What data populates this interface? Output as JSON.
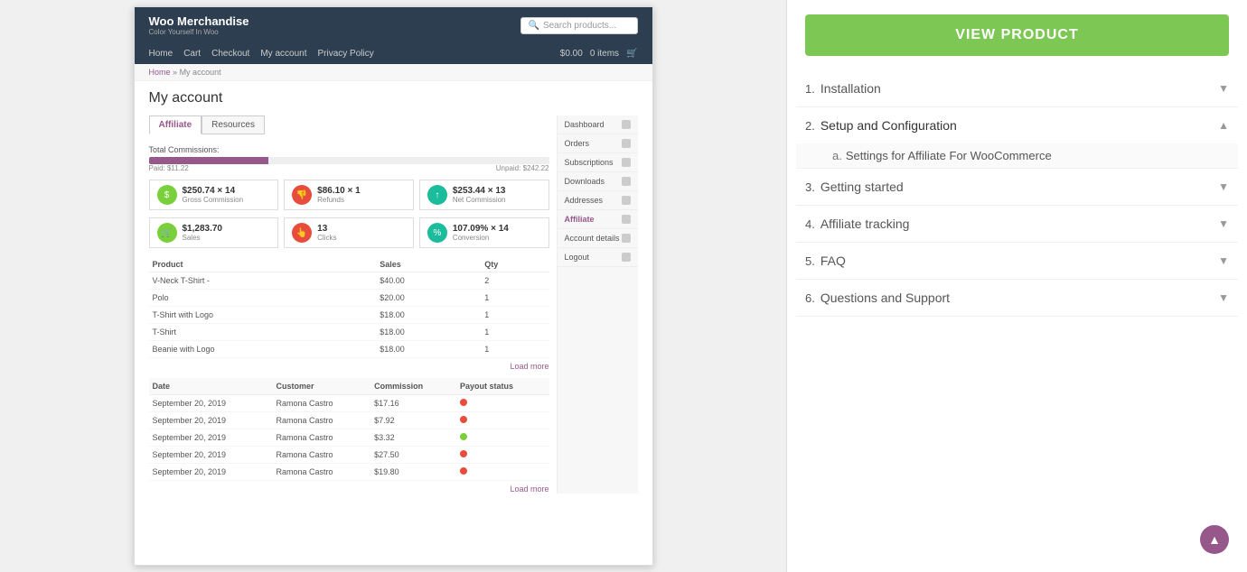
{
  "woo": {
    "brand_name": "Woo Merchandise",
    "brand_tagline": "Color Yourself In Woo",
    "search_placeholder": "Search products...",
    "nav_links": [
      "Home",
      "Cart",
      "Checkout",
      "My account",
      "Privacy Policy"
    ],
    "cart_amount": "$0.00",
    "cart_items": "0 items",
    "breadcrumb_home": "Home",
    "breadcrumb_separator": "»",
    "breadcrumb_current": "My account",
    "page_title": "My account",
    "tabs": [
      "Affiliate",
      "Resources"
    ],
    "commission_label": "Total Commissions:",
    "commission_paid": "Paid: $11.22",
    "commission_unpaid": "Unpaid: $242.22",
    "stat_gross": "$250.74 × 14",
    "stat_gross_label": "Gross Commission",
    "stat_refund": "$86.10 × 1",
    "stat_refund_label": "Refunds",
    "stat_net": "$253.44 × 13",
    "stat_net_label": "Net Commission",
    "stat_sales": "$1,283.70",
    "stat_sales_label": "Sales",
    "stat_clicks": "13",
    "stat_clicks_label": "Clicks",
    "stat_conversion": "107.09% × 14",
    "stat_conversion_label": "Conversion",
    "products_table": {
      "headers": [
        "Product",
        "Sales",
        "Qty"
      ],
      "rows": [
        {
          "product": "V-Neck T-Shirt -",
          "sales": "$40.00",
          "qty": "2"
        },
        {
          "product": "Polo",
          "sales": "$20.00",
          "qty": "1"
        },
        {
          "product": "T-Shirt with Logo",
          "sales": "$18.00",
          "qty": "1"
        },
        {
          "product": "T-Shirt",
          "sales": "$18.00",
          "qty": "1"
        },
        {
          "product": "Beanie with Logo",
          "sales": "$18.00",
          "qty": "1"
        }
      ]
    },
    "load_more": "Load more",
    "history_table": {
      "headers": [
        "Date",
        "Customer",
        "Commission",
        "Payout status"
      ],
      "rows": [
        {
          "date": "September 20, 2019",
          "customer": "Ramona Castro",
          "commission": "$17.16",
          "status": "red"
        },
        {
          "date": "September 20, 2019",
          "customer": "Ramona Castro",
          "commission": "$7.92",
          "status": "red"
        },
        {
          "date": "September 20, 2019",
          "customer": "Ramona Castro",
          "commission": "$3.32",
          "status": "green"
        },
        {
          "date": "September 20, 2019",
          "customer": "Ramona Castro",
          "commission": "$27.50",
          "status": "red"
        },
        {
          "date": "September 20, 2019",
          "customer": "Ramona Castro",
          "commission": "$19.80",
          "status": "red"
        }
      ]
    },
    "load_more_history": "Load more",
    "sidebar_menu": [
      {
        "label": "Dashboard",
        "active": false
      },
      {
        "label": "Orders",
        "active": false
      },
      {
        "label": "Subscriptions",
        "active": false
      },
      {
        "label": "Downloads",
        "active": false
      },
      {
        "label": "Addresses",
        "active": false
      },
      {
        "label": "Affiliate",
        "active": true
      },
      {
        "label": "Account details",
        "active": false
      },
      {
        "label": "Logout",
        "active": false
      }
    ]
  },
  "docs": {
    "view_product_btn": "VIEW PRODUCT",
    "toc": [
      {
        "number": "1.",
        "label": "Installation",
        "expanded": false,
        "sub_items": []
      },
      {
        "number": "2.",
        "label": "Setup and Configuration",
        "expanded": true,
        "sub_items": [
          {
            "letter": "a.",
            "label": "Settings for Affiliate For WooCommerce"
          }
        ]
      },
      {
        "number": "3.",
        "label": "Getting started",
        "expanded": false,
        "sub_items": []
      },
      {
        "number": "4.",
        "label": "Affiliate tracking",
        "expanded": false,
        "sub_items": []
      },
      {
        "number": "5.",
        "label": "FAQ",
        "expanded": false,
        "sub_items": []
      },
      {
        "number": "6.",
        "label": "Questions and Support",
        "expanded": false,
        "sub_items": []
      }
    ]
  }
}
